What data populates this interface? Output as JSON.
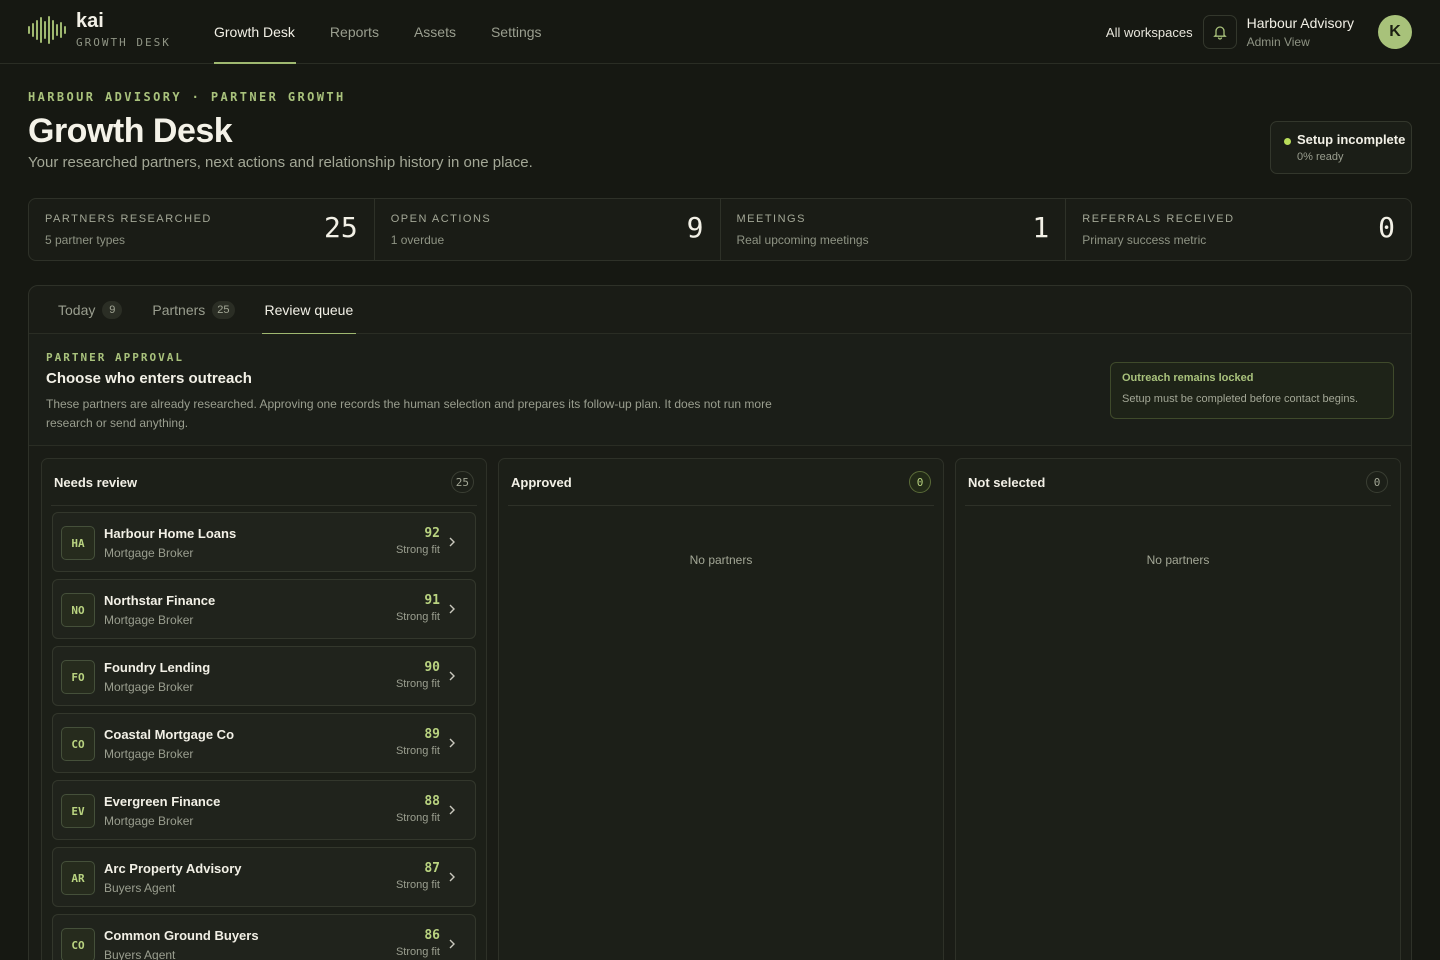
{
  "brand": {
    "name": "kai",
    "subtitle": "GROWTH DESK"
  },
  "nav": [
    {
      "label": "Growth Desk",
      "active": true
    },
    {
      "label": "Reports",
      "active": false
    },
    {
      "label": "Assets",
      "active": false
    },
    {
      "label": "Settings",
      "active": false
    }
  ],
  "topbar": {
    "workspace_switch": "All workspaces",
    "bell_icon": "bell-icon",
    "account_org": "Harbour Advisory",
    "account_role": "Admin View",
    "avatar_initial": "K"
  },
  "header": {
    "eyebrow": "HARBOUR ADVISORY · PARTNER GROWTH",
    "title": "Growth Desk",
    "subtitle": "Your researched partners, next actions and relationship history in one place.",
    "setup_status": "Setup incomplete",
    "setup_progress": "0% ready"
  },
  "stats": [
    {
      "label": "PARTNERS RESEARCHED",
      "sub": "5 partner types",
      "value": "25"
    },
    {
      "label": "OPEN ACTIONS",
      "sub": "1 overdue",
      "value": "9"
    },
    {
      "label": "MEETINGS",
      "sub": "Real upcoming meetings",
      "value": "1"
    },
    {
      "label": "REFERRALS RECEIVED",
      "sub": "Primary success metric",
      "value": "0"
    }
  ],
  "tabs": [
    {
      "label": "Today",
      "count": "9",
      "active": false
    },
    {
      "label": "Partners",
      "count": "25",
      "active": false
    },
    {
      "label": "Review queue",
      "count": "",
      "active": true
    }
  ],
  "approval": {
    "eyebrow": "PARTNER APPROVAL",
    "title": "Choose who enters outreach",
    "description": "These partners are already researched. Approving one records the human selection and prepares its follow-up plan. It does not run more research or send anything.",
    "lock_title": "Outreach remains locked",
    "lock_text": "Setup must be completed before contact begins."
  },
  "columns": {
    "needs_review": {
      "title": "Needs review",
      "count": "25"
    },
    "approved": {
      "title": "Approved",
      "count": "0",
      "empty": "No partners"
    },
    "not_selected": {
      "title": "Not selected",
      "count": "0",
      "empty": "No partners"
    }
  },
  "partners": [
    {
      "initials": "HA",
      "name": "Harbour Home Loans",
      "type": "Mortgage Broker",
      "score": "92",
      "fit": "Strong fit"
    },
    {
      "initials": "NO",
      "name": "Northstar Finance",
      "type": "Mortgage Broker",
      "score": "91",
      "fit": "Strong fit"
    },
    {
      "initials": "FO",
      "name": "Foundry Lending",
      "type": "Mortgage Broker",
      "score": "90",
      "fit": "Strong fit"
    },
    {
      "initials": "CO",
      "name": "Coastal Mortgage Co",
      "type": "Mortgage Broker",
      "score": "89",
      "fit": "Strong fit"
    },
    {
      "initials": "EV",
      "name": "Evergreen Finance",
      "type": "Mortgage Broker",
      "score": "88",
      "fit": "Strong fit"
    },
    {
      "initials": "AR",
      "name": "Arc Property Advisory",
      "type": "Buyers Agent",
      "score": "87",
      "fit": "Strong fit"
    },
    {
      "initials": "CO",
      "name": "Common Ground Buyers",
      "type": "Buyers Agent",
      "score": "86",
      "fit": "Strong fit"
    }
  ],
  "colors": {
    "accent": "#9fb870",
    "accent_bright": "#b9d380",
    "background": "#161812",
    "status_dot": "#b9dd5a"
  }
}
